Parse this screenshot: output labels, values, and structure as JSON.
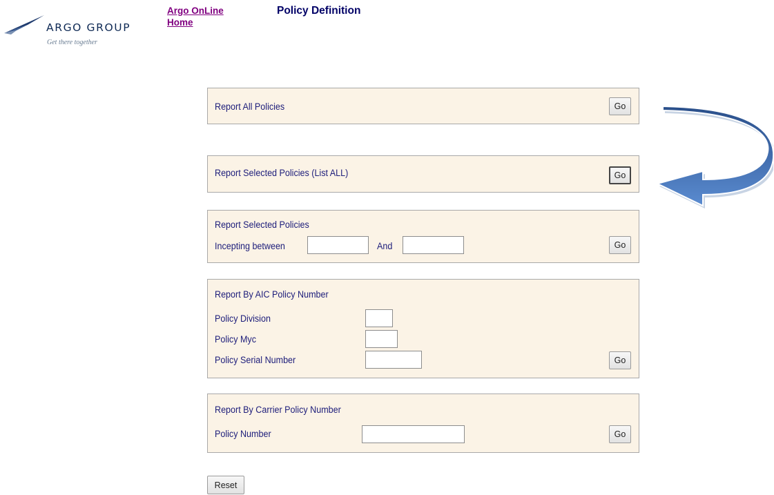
{
  "header": {
    "logo": {
      "wordmark": "ARGO GROUP",
      "tagline": "Get there together",
      "icon": "argo-plane-icon"
    },
    "nav": {
      "link1": "Argo OnLine",
      "link2": "Home"
    },
    "title": "Policy Definition"
  },
  "sections": {
    "all_policies": {
      "label": "Report All Policies",
      "go": "Go"
    },
    "selected_list_all": {
      "label": "Report Selected Policies (List ALL)",
      "go": "Go"
    },
    "selected_incepting": {
      "title": "Report Selected Policies",
      "between_label": "Incepting between",
      "and_label": "And",
      "from_value": "",
      "to_value": "",
      "go": "Go"
    },
    "aic_policy": {
      "title": "Report By AIC Policy Number",
      "division_label": "Policy Division",
      "myc_label": "Policy Myc",
      "serial_label": "Policy Serial Number",
      "division_value": "",
      "myc_value": "",
      "serial_value": "",
      "go": "Go"
    },
    "carrier_policy": {
      "title": "Report By Carrier Policy Number",
      "number_label": "Policy Number",
      "number_value": "",
      "go": "Go"
    }
  },
  "reset_label": "Reset",
  "annotation": {
    "icon": "curved-arrow-icon",
    "color": "#3f6fb0"
  },
  "colors": {
    "panel_bg": "#fbf3e6",
    "label": "#1c1c7a",
    "title": "#000066",
    "link": "#800080"
  }
}
